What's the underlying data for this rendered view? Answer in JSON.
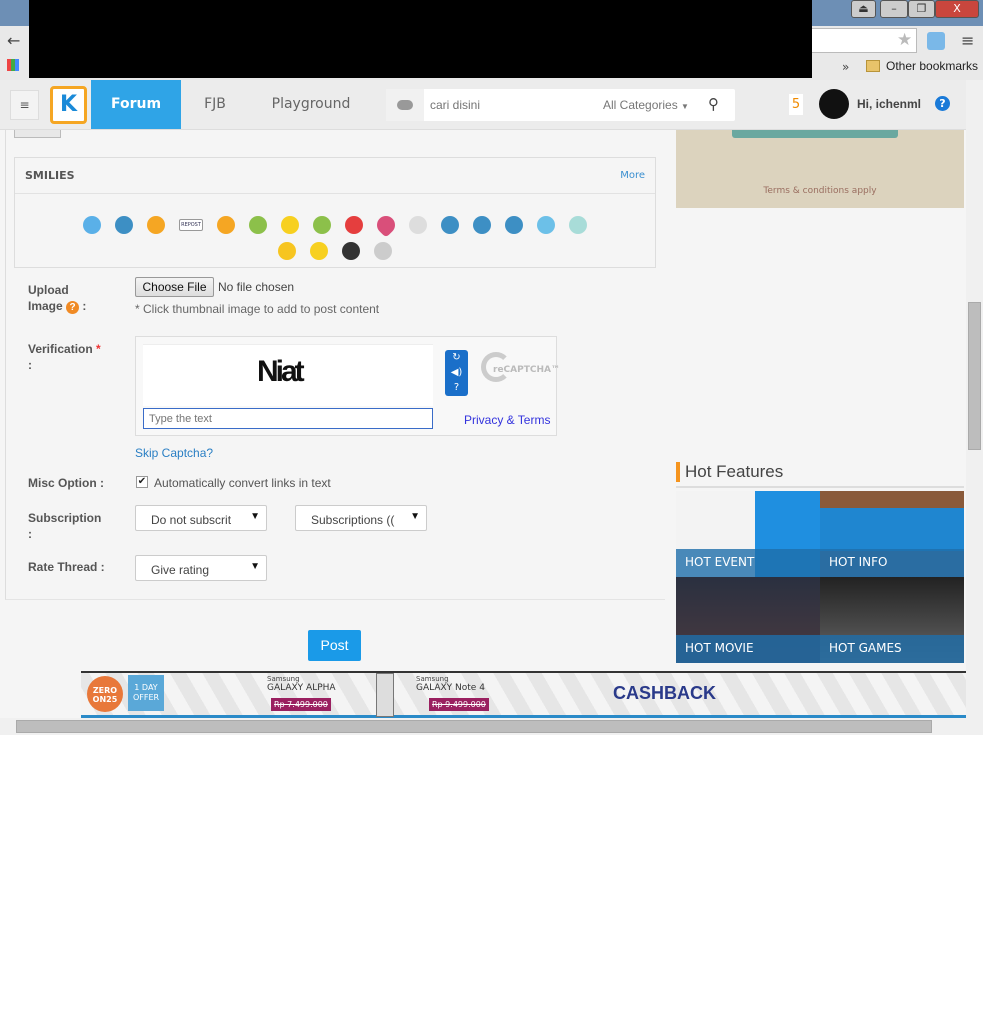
{
  "browser": {
    "bookmarks": {
      "overflow": "»",
      "other": "Other bookmarks"
    }
  },
  "header": {
    "nav": [
      "Forum",
      "FJB",
      "Playground"
    ],
    "search_placeholder": "cari disini",
    "category": "All Categories",
    "notif_count": "5",
    "greeting": "Hi, ichenml",
    "help": "?"
  },
  "smilies": {
    "title": "SMILIES",
    "more": "More",
    "repost_label": "REPOST",
    "colors": [
      "#5ab0e8",
      "#3d8fc4",
      "#f5a623",
      "#ffffff",
      "#f5a623",
      "#8cc04a",
      "#f7d020",
      "#8cc04a",
      "#e53e3e",
      "#d94f7a",
      "#dddddd",
      "#3d8fc4",
      "#3d8fc4",
      "#3d8fc4",
      "#6cc0e8",
      "#a8dcd8",
      "#f7c520",
      "#f7d020",
      "#333333",
      "#cccccc"
    ]
  },
  "upload": {
    "label_line1": "Upload",
    "label_line2": "Image",
    "help": "?",
    "colon": ":",
    "button": "Choose File",
    "status": "No file chosen",
    "hint": "* Click thumbnail image to add to post content"
  },
  "verification": {
    "label": "Verification",
    "required": "*",
    "colon": ":",
    "captcha_word": "Niat",
    "placeholder": "Type the text",
    "recaptcha": "reCAPTCHA™",
    "privacy": "Privacy & Terms",
    "skip": "Skip Captcha?"
  },
  "misc": {
    "label": "Misc Option :",
    "checkbox_label": "Automatically convert links in text",
    "checked": true
  },
  "subscription": {
    "label": "Subscription",
    "colon": ":",
    "option1": "Do not subscrit",
    "option2": "Subscriptions (("
  },
  "rate": {
    "label": "Rate Thread :",
    "value": "Give rating"
  },
  "post_button": "Post",
  "sidebar": {
    "terms": "Terms & conditions apply",
    "hot_title": "Hot Features",
    "tiles": [
      "HOT EVENT",
      "HOT INFO",
      "HOT MOVIE",
      "HOT GAMES"
    ]
  },
  "ad": {
    "badge1": "ZERO ON25",
    "badge2": "1 DAY OFFER",
    "brand1": "Samsung",
    "product1": "GALAXY ALPHA",
    "price1": "Rp 7.499.000",
    "brand2": "Samsung",
    "product2": "GALAXY Note 4",
    "price2": "Rp 9.499.000",
    "headline": "CASHBACK"
  },
  "accent": "#2fa4e7"
}
